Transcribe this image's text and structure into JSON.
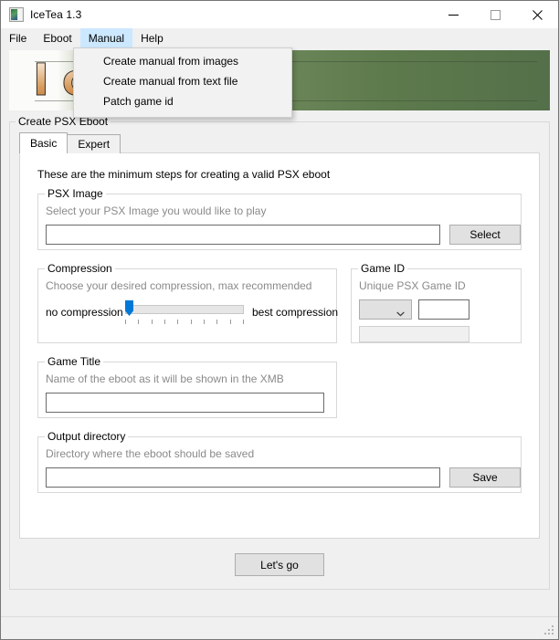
{
  "window": {
    "title": "IceTea 1.3",
    "icon": "app-image-icon",
    "minimize_label": "—",
    "maximize_label": "▢",
    "close_label": "✕"
  },
  "menubar": {
    "items": [
      {
        "label": "File",
        "open": false
      },
      {
        "label": "Eboot",
        "open": false
      },
      {
        "label": "Manual",
        "open": true
      },
      {
        "label": "Help",
        "open": false
      }
    ]
  },
  "dropdown": {
    "owner": "Manual",
    "items": [
      {
        "label": "Create manual from images"
      },
      {
        "label": "Create manual from text file"
      },
      {
        "label": "Patch game id"
      }
    ]
  },
  "banner": {
    "text": "IceTea",
    "bg_start": "#fbfbf9",
    "bg_end": "#54704a",
    "letter_color": "#d79c5e"
  },
  "main": {
    "group_title": "Create PSX Eboot",
    "tabs": [
      {
        "label": "Basic",
        "active": true
      },
      {
        "label": "Expert",
        "active": false
      }
    ],
    "intro": "These are the minimum steps for creating a valid PSX eboot",
    "psx_image": {
      "title": "PSX Image",
      "hint": "Select your PSX Image you would like to play",
      "value": "",
      "placeholder": "",
      "button_label": "Select"
    },
    "compression": {
      "title": "Compression",
      "hint": "Choose your desired compression, max recommended",
      "min_label": "no compression",
      "max_label": "best compression",
      "value": 0,
      "min": 0,
      "max": 9,
      "tick_count": 10
    },
    "game_id": {
      "title": "Game ID",
      "hint": "Unique PSX Game ID",
      "select_value": "",
      "select_options": [],
      "id_value": "",
      "readonly_value": ""
    },
    "game_title": {
      "title": "Game Title",
      "hint": "Name of the eboot as it will be shown in the XMB",
      "value": "",
      "placeholder": ""
    },
    "output_directory": {
      "title": "Output directory",
      "hint": "Directory where the eboot should be saved",
      "value": "",
      "placeholder": "",
      "button_label": "Save"
    },
    "go_button_label": "Let's go"
  },
  "statusbar": {
    "text": ""
  }
}
